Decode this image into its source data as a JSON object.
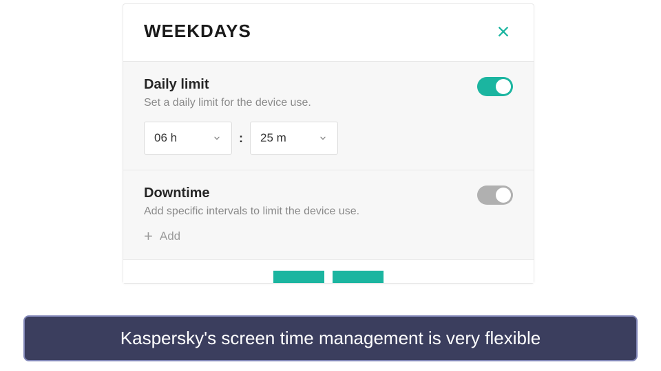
{
  "dialog": {
    "title": "WEEKDAYS"
  },
  "daily_limit": {
    "title": "Daily limit",
    "desc": "Set a daily limit for the device use.",
    "enabled": true,
    "hours": "06 h",
    "minutes": "25 m",
    "separator": ":"
  },
  "downtime": {
    "title": "Downtime",
    "desc": "Add specific intervals to limit the device use.",
    "enabled": false,
    "add_label": "Add"
  },
  "caption": "Kaspersky's screen time management is very flexible"
}
